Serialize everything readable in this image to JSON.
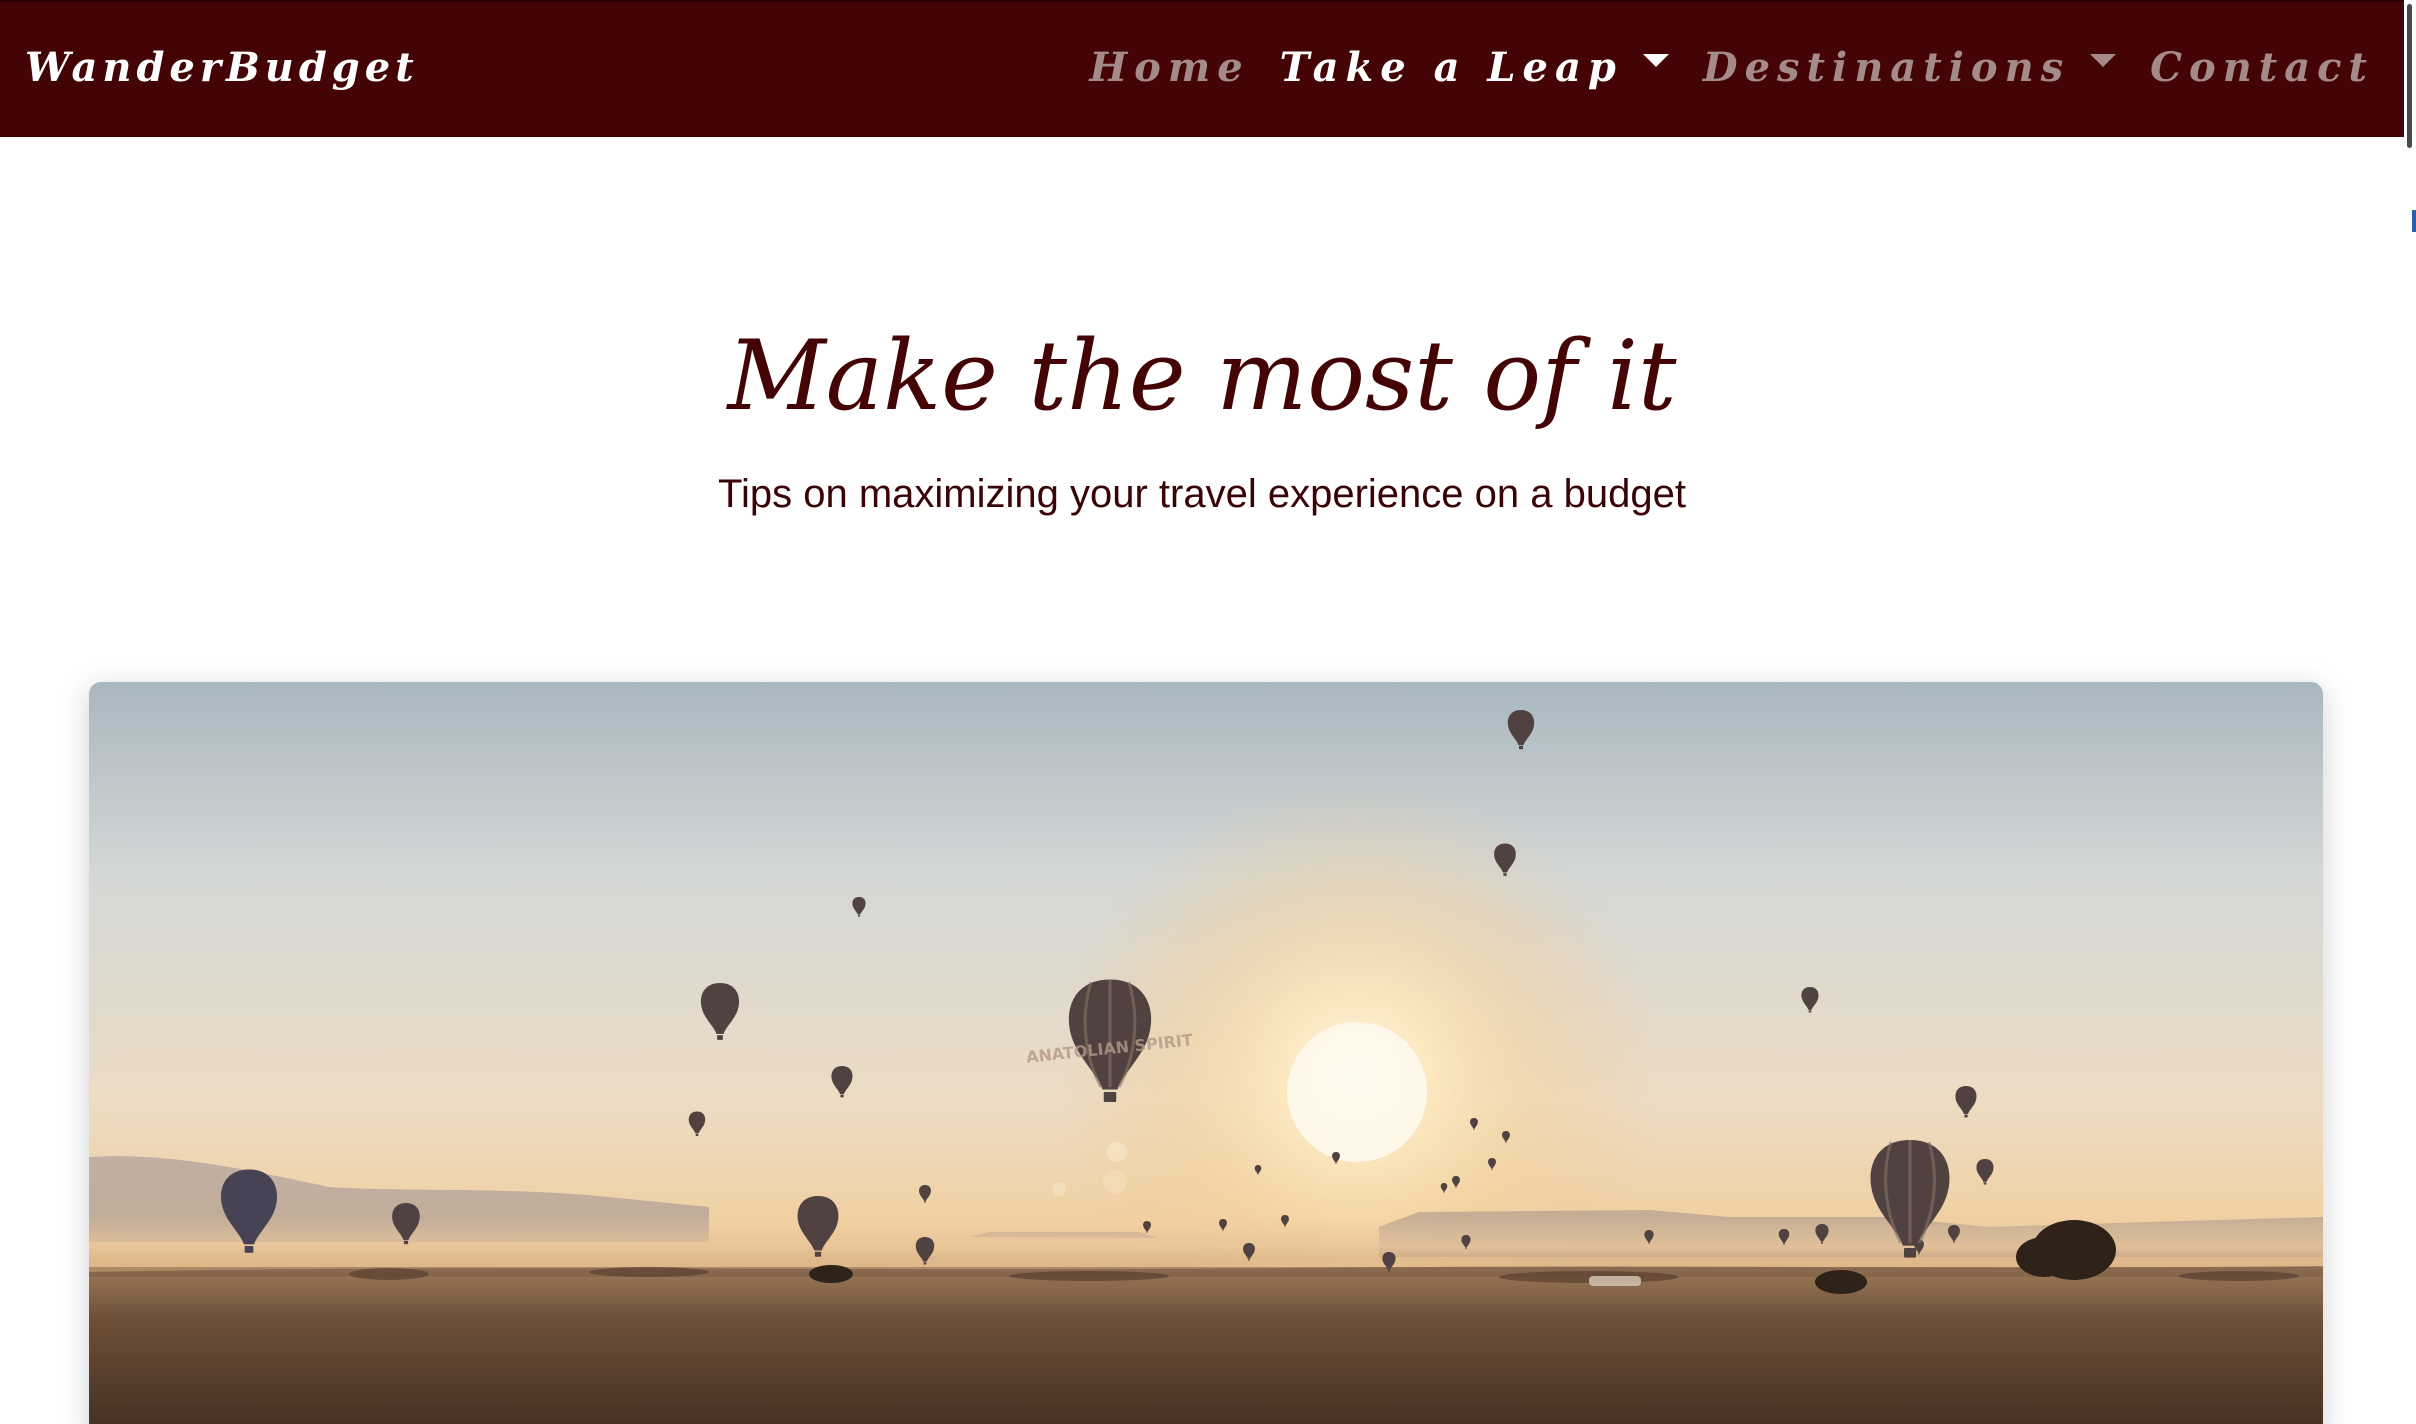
{
  "navbar": {
    "brand": "WanderBudget",
    "items": [
      {
        "label": "Home",
        "dropdown": false,
        "active": false
      },
      {
        "label": "Take a Leap",
        "dropdown": true,
        "active": true
      },
      {
        "label": "Destinations",
        "dropdown": true,
        "active": false
      },
      {
        "label": "Contact",
        "dropdown": false,
        "active": false
      }
    ]
  },
  "hero": {
    "title": "Make the most of it",
    "subtitle": "Tips on maximizing your travel experience on a budget"
  },
  "photo": {
    "subject": "hot-air-balloons-at-sunrise",
    "balloon_text": "ANATOLIAN SPIRIT"
  },
  "colors": {
    "navbar_bg": "#440305",
    "brand_text": "#ffffff",
    "nav_inactive": "#a58a8a",
    "nav_active": "#ffffff",
    "heading": "#440305",
    "page_bg": "#ffffff"
  }
}
